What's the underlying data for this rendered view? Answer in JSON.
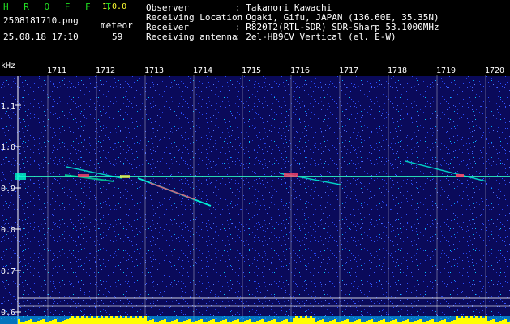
{
  "app": {
    "name": "H R O F F T",
    "version": "1.0.0"
  },
  "file": {
    "name": "2508181710.png",
    "timestamp": "25.08.18 17:10"
  },
  "meteor": {
    "label": "meteor",
    "count": "59"
  },
  "info": [
    {
      "label": "Observer",
      "value": ": Takanori Kawachi"
    },
    {
      "label": "Receiving Location",
      "value": ": Ogaki, Gifu, JAPAN (136.60E, 35.35N)"
    },
    {
      "label": "Receiver",
      "value": ": R820T2(RTL-SDR) SDR-Sharp 53.1000MHz"
    },
    {
      "label": "Receiving antenna",
      "value": ": 2el-HB9CV Vertical (el. E-W)"
    }
  ],
  "spectrogram": {
    "unit_label": "kHz",
    "time_labels": [
      "1711",
      "1712",
      "1713",
      "1714",
      "1715",
      "1716",
      "1717",
      "1718",
      "1719",
      "1720"
    ],
    "freq_labels": [
      "1.1",
      "1.0",
      "0.9",
      "0.8",
      "0.7",
      "0.6"
    ],
    "colors": {
      "background": "#0a0a5a",
      "noise": "#2a4dff",
      "carrier": "#00ffdd",
      "echo": "#ff4466",
      "level": "#ffff00",
      "axis": "#ffffff"
    }
  }
}
